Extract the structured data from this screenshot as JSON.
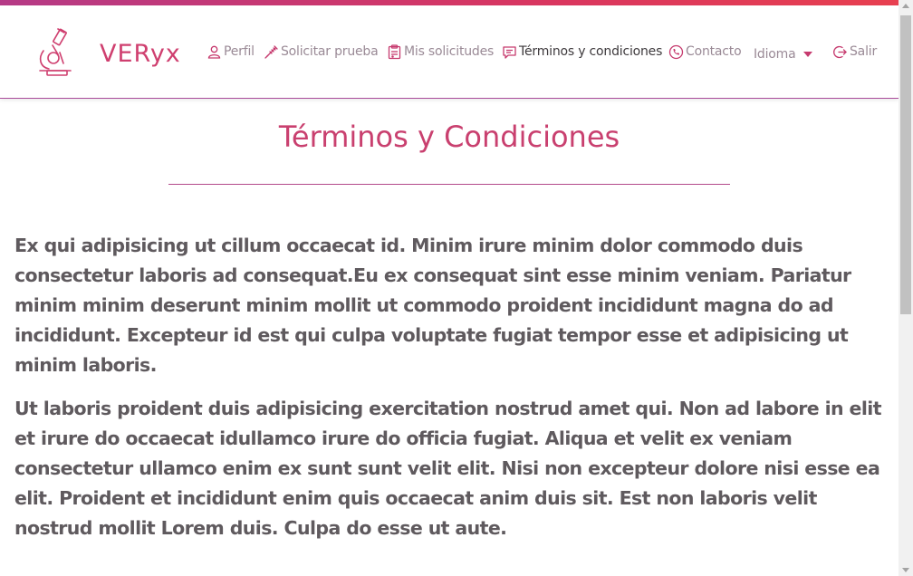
{
  "colors": {
    "accent": "#cf3f6f",
    "accent_purple": "#a94a9a",
    "text": "#5f5a5e",
    "nav_text": "#9a8a96",
    "nav_active": "#3e3a3d"
  },
  "brand": {
    "name": "VERyx",
    "icon": "microscope-icon"
  },
  "nav": {
    "profile": {
      "label": "Perfil",
      "icon": "user-icon"
    },
    "request_test": {
      "label": "Solicitar prueba",
      "icon": "syringe-icon"
    },
    "my_requests": {
      "label": "Mis solicitudes",
      "icon": "clipboard-icon"
    },
    "terms": {
      "label": "Términos y condiciones",
      "icon": "message-icon"
    },
    "contact": {
      "label": "Contacto",
      "icon": "phone-icon"
    },
    "language": {
      "label": "Idioma",
      "icon": "caret-down-icon"
    },
    "logout": {
      "label": "Salir",
      "icon": "logout-icon"
    }
  },
  "page": {
    "title": "Términos y Condiciones",
    "paragraphs": [
      "Ex qui adipisicing ut cillum occaecat id. Minim irure minim dolor commodo duis consectetur laboris ad consequat.Eu ex consequat sint esse minim veniam. Pariatur minim minim deserunt minim mollit ut commodo proident incididunt magna do ad incididunt. Excepteur id est qui culpa voluptate fugiat tempor esse et adipisicing ut minim laboris.",
      "Ut laboris proident duis adipisicing exercitation nostrud amet qui. Non ad labore in elit et irure do occaecat idullamco irure do officia fugiat. Aliqua et velit ex veniam consectetur ullamco enim ex sunt sunt velit elit. Nisi non excepteur dolore nisi esse ea elit. Proident et incididunt enim quis occaecat anim duis sit. Est non laboris velit nostrud mollit Lorem duis. Culpa do esse ut aute."
    ]
  }
}
